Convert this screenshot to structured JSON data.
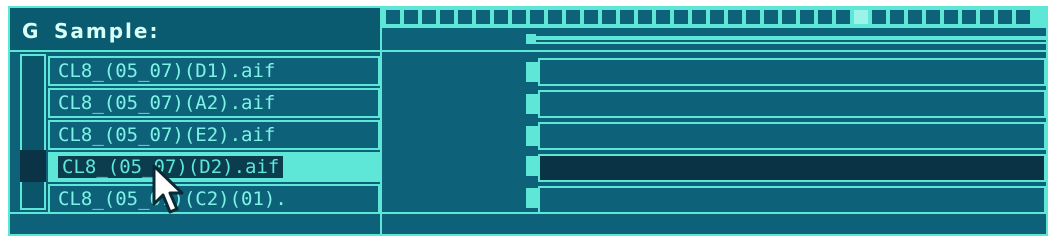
{
  "panel": {
    "group_letter": "G",
    "title": "Sample:"
  },
  "files": [
    {
      "name": "CL8_(05_07)(D1).aif",
      "selected": false
    },
    {
      "name": "CL8_(05_07)(A2).aif",
      "selected": false
    },
    {
      "name": "CL8_(05_07)(E2).aif",
      "selected": false
    },
    {
      "name": "CL8_(05_07)(D2).aif",
      "selected": true
    },
    {
      "name": "CL8_(05_07)(C2)(01).",
      "selected": false
    }
  ],
  "colors": {
    "panel_bg": "#0d6178",
    "accent": "#5ee6d6",
    "selected_lane": "#0a3446",
    "text": "#7ff2e6"
  },
  "icons": {
    "cursor": "mouse-pointer-icon"
  }
}
